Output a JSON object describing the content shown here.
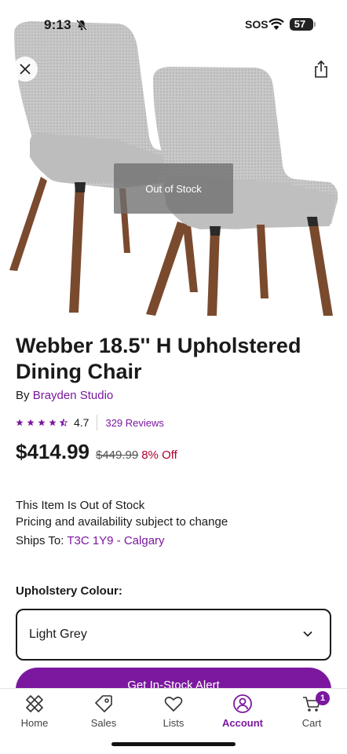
{
  "status_bar": {
    "time": "9:13",
    "carrier": "SOS",
    "battery": "57"
  },
  "product": {
    "image_alt": "Two grey upholstered dining chairs with wooden legs",
    "overlay": "Out of Stock",
    "title": "Webber 18.5'' H Upholstered Dining Chair",
    "brand_prefix": "By ",
    "brand": "Brayden Studio",
    "rating": "4.7",
    "stars": 4.5,
    "reviews": "329 Reviews",
    "price": "$414.99",
    "original_price": "$449.99",
    "discount": "8% Off"
  },
  "availability": {
    "stock_message": "This Item Is Out of Stock",
    "pricing_message": "Pricing and availability subject to change",
    "ships_label": "Ships To: ",
    "ships_location": "T3C 1Y9 - Calgary"
  },
  "options": {
    "label": "Upholstery Colour:",
    "selected": "Light Grey"
  },
  "cta": {
    "label": "Get In-Stock Alert"
  },
  "tabbar": {
    "home": "Home",
    "sales": "Sales",
    "lists": "Lists",
    "account": "Account",
    "cart": "Cart",
    "cart_count": "1"
  },
  "colors": {
    "brand_purple": "#7b189f",
    "discount_red": "#b2002d",
    "chair_fabric": "#c4c4c4",
    "chair_legs": "#7a4a2e"
  }
}
